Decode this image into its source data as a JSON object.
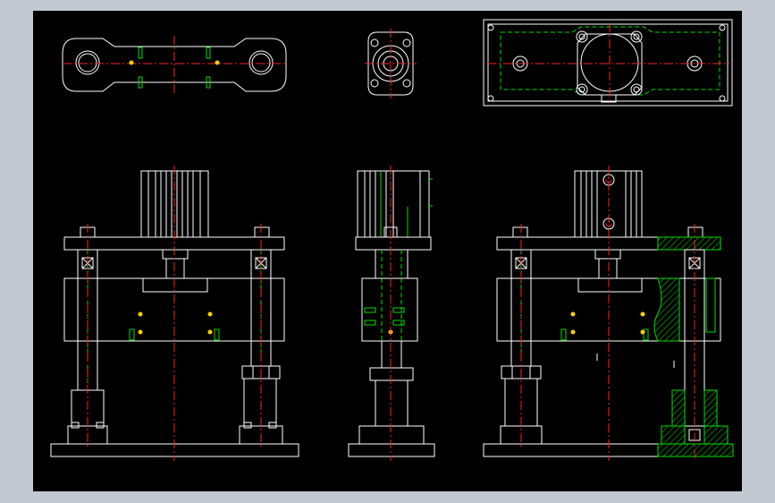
{
  "drawing": {
    "view_labels": [
      "",
      "",
      ""
    ],
    "notes": [
      "",
      ""
    ]
  },
  "colors": {
    "frame_background": "#c3c9d1",
    "sheet_background": "#000000",
    "outline": "#ffffff",
    "hidden_line": "#00e000",
    "center_line": "#ff2020",
    "label_text": "#22dddd"
  }
}
